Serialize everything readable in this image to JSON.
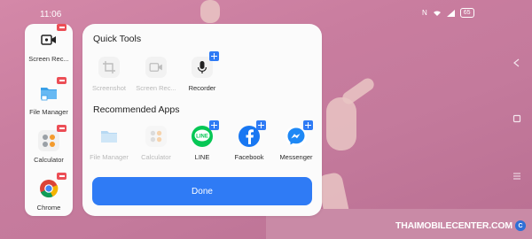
{
  "status_bar": {
    "time": "11:06",
    "icons": [
      "nfc-icon",
      "wifi-icon",
      "signal-icon"
    ],
    "battery": "65"
  },
  "sidebar": {
    "items": [
      {
        "label": "Screen Rec...",
        "icon": "screen-record-icon"
      },
      {
        "label": "File Manager",
        "icon": "folder-icon"
      },
      {
        "label": "Calculator",
        "icon": "calculator-icon"
      },
      {
        "label": "Chrome",
        "icon": "chrome-icon"
      }
    ]
  },
  "panel": {
    "quick_tools_title": "Quick Tools",
    "quick_tools": [
      {
        "label": "Screenshot",
        "icon": "crop-icon",
        "enabled": false
      },
      {
        "label": "Screen Rec...",
        "icon": "screen-record-icon",
        "enabled": false
      },
      {
        "label": "Recorder",
        "icon": "microphone-icon",
        "enabled": true
      }
    ],
    "recommended_title": "Recommended Apps",
    "recommended_apps": [
      {
        "label": "File Manager",
        "icon": "folder-icon",
        "enabled": false
      },
      {
        "label": "Calculator",
        "icon": "calculator-icon",
        "enabled": false
      },
      {
        "label": "LINE",
        "icon": "line-icon",
        "enabled": true
      },
      {
        "label": "Facebook",
        "icon": "facebook-icon",
        "enabled": true
      },
      {
        "label": "Messenger",
        "icon": "messenger-icon",
        "enabled": true
      }
    ],
    "done_label": "Done"
  },
  "watermark": {
    "text": "THAIMOBILECENTER.COM",
    "badge": "C"
  },
  "colors": {
    "accent": "#2f7bf5",
    "remove_badge": "#ec4e56",
    "line_green": "#06c755",
    "facebook_blue": "#1877f2"
  }
}
